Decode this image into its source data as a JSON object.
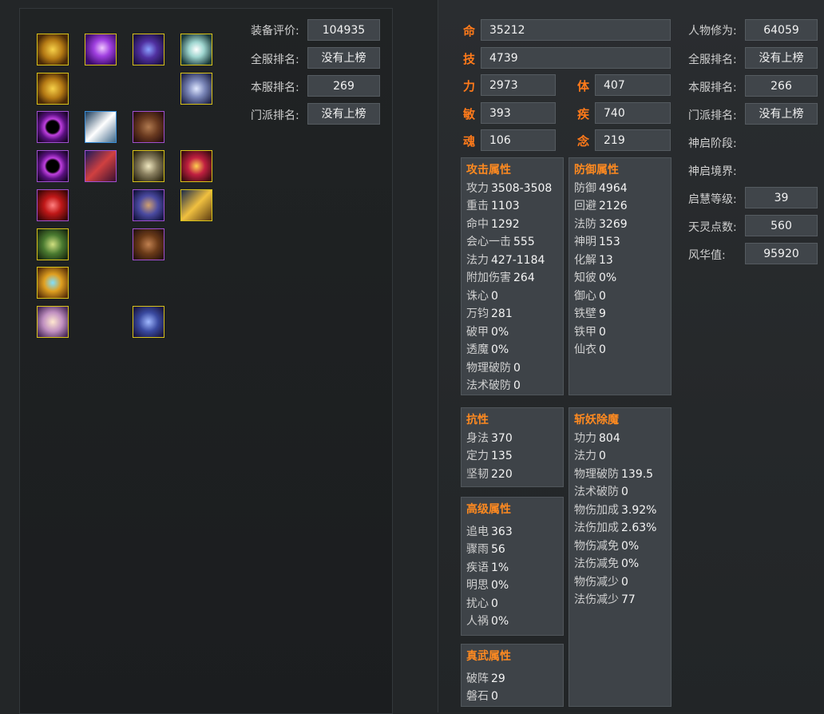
{
  "colors": {
    "accent": "#ff7a1a",
    "box_bg": "#3e4348",
    "value_bg": "#40454a",
    "slot_gold": "#d8c21a",
    "slot_purple": "#a050d0",
    "slot_blue": "#3a8ed8"
  },
  "left_info": [
    {
      "label": "装备评价:",
      "value": "104935"
    },
    {
      "label": "全服排名:",
      "value": "没有上榜"
    },
    {
      "label": "本服排名:",
      "value": "269"
    },
    {
      "label": "门派排名:",
      "value": "没有上榜"
    }
  ],
  "equipment": [
    {
      "icon": "gold-ornament-icon"
    },
    {
      "icon": "purple-orb-icon"
    },
    {
      "icon": "armor-pauldron-icon"
    },
    {
      "icon": "white-crane-icon"
    },
    {
      "icon": "gold-ornament-icon"
    },
    {
      "icon": "silver-helmet-icon"
    },
    {
      "icon": "dark-ring-icon"
    },
    {
      "icon": "white-feather-icon"
    },
    {
      "icon": "brown-robe-icon"
    },
    {
      "icon": "dark-ring-icon"
    },
    {
      "icon": "red-scroll-icon"
    },
    {
      "icon": "silver-armor-icon"
    },
    {
      "icon": "red-amulet-icon"
    },
    {
      "icon": "red-gem-icon"
    },
    {
      "icon": "warrior-figure-icon"
    },
    {
      "icon": "gold-scepter-icon"
    },
    {
      "icon": "jade-box-icon"
    },
    {
      "icon": "brown-trousers-icon"
    },
    {
      "icon": "gold-crest-icon"
    },
    {
      "icon": "parchment-icon"
    },
    {
      "icon": "blue-boot-icon"
    }
  ],
  "attrs": {
    "ming": {
      "label": "命",
      "value": "35212"
    },
    "ji": {
      "label": "技",
      "value": "4739"
    },
    "li": {
      "label": "力",
      "value": "2973"
    },
    "ti": {
      "label": "体",
      "value": "407"
    },
    "min": {
      "label": "敏",
      "value": "393"
    },
    "jiyi": {
      "label": "疾",
      "value": "740"
    },
    "hun": {
      "label": "魂",
      "value": "106"
    },
    "nian": {
      "label": "念",
      "value": "219"
    }
  },
  "right_info": [
    {
      "label": "人物修为:",
      "value": "64059"
    },
    {
      "label": "全服排名:",
      "value": "没有上榜"
    },
    {
      "label": "本服排名:",
      "value": "266"
    },
    {
      "label": "门派排名:",
      "value": "没有上榜"
    },
    {
      "label": "神启阶段:",
      "value": ""
    },
    {
      "label": "神启境界:",
      "value": ""
    },
    {
      "label": "启慧等级:",
      "value": "39"
    },
    {
      "label": "天灵点数:",
      "value": "560"
    },
    {
      "label": "风华值:",
      "value": "95920"
    }
  ],
  "attack": {
    "title": "攻击属性",
    "rows": [
      {
        "n": "攻力",
        "v": "3508-3508"
      },
      {
        "n": "重击",
        "v": "1103"
      },
      {
        "n": "命中",
        "v": "1292"
      },
      {
        "n": "会心一击",
        "v": "555"
      },
      {
        "n": "法力",
        "v": "427-1184"
      },
      {
        "n": "附加伤害",
        "v": "264"
      },
      {
        "n": "诛心",
        "v": "0"
      },
      {
        "n": "万钧",
        "v": "281"
      },
      {
        "n": "破甲",
        "v": "0%"
      },
      {
        "n": "透魔",
        "v": "0%"
      },
      {
        "n": "物理破防",
        "v": "0"
      },
      {
        "n": "法术破防",
        "v": "0"
      }
    ]
  },
  "defense": {
    "title": "防御属性",
    "rows": [
      {
        "n": "防御",
        "v": "4964"
      },
      {
        "n": "回避",
        "v": "2126"
      },
      {
        "n": "法防",
        "v": "3269"
      },
      {
        "n": "神明",
        "v": "153"
      },
      {
        "n": "化解",
        "v": "13"
      },
      {
        "n": "知彼",
        "v": "0%"
      },
      {
        "n": "御心",
        "v": "0"
      },
      {
        "n": "铁壁",
        "v": "9"
      },
      {
        "n": "铁甲",
        "v": "0"
      },
      {
        "n": "仙衣",
        "v": "0"
      }
    ]
  },
  "resist": {
    "title": "抗性",
    "rows": [
      {
        "n": "身法",
        "v": "370"
      },
      {
        "n": "定力",
        "v": "135"
      },
      {
        "n": "坚韧",
        "v": "220"
      }
    ]
  },
  "demon": {
    "title": "斩妖除魔",
    "rows": [
      {
        "n": "功力",
        "v": "804"
      },
      {
        "n": "法力",
        "v": "0"
      },
      {
        "n": "物理破防",
        "v": "139.5"
      },
      {
        "n": "法术破防",
        "v": "0"
      },
      {
        "n": "物伤加成",
        "v": "3.92%"
      },
      {
        "n": "法伤加成",
        "v": "2.63%"
      },
      {
        "n": "物伤减免",
        "v": "0%"
      },
      {
        "n": "法伤减免",
        "v": "0%"
      },
      {
        "n": "物伤减少",
        "v": "0"
      },
      {
        "n": "法伤减少",
        "v": "77"
      }
    ]
  },
  "advanced": {
    "title": "高级属性",
    "rows": [
      {
        "n": "追电",
        "v": "363"
      },
      {
        "n": "骤雨",
        "v": "56"
      },
      {
        "n": "疾语",
        "v": "1%"
      },
      {
        "n": "明思",
        "v": "0%"
      },
      {
        "n": "扰心",
        "v": "0"
      },
      {
        "n": "人祸",
        "v": "0%"
      }
    ]
  },
  "zhenwu": {
    "title": "真武属性",
    "rows": [
      {
        "n": "破阵",
        "v": "29"
      },
      {
        "n": "磐石",
        "v": "0"
      }
    ]
  }
}
